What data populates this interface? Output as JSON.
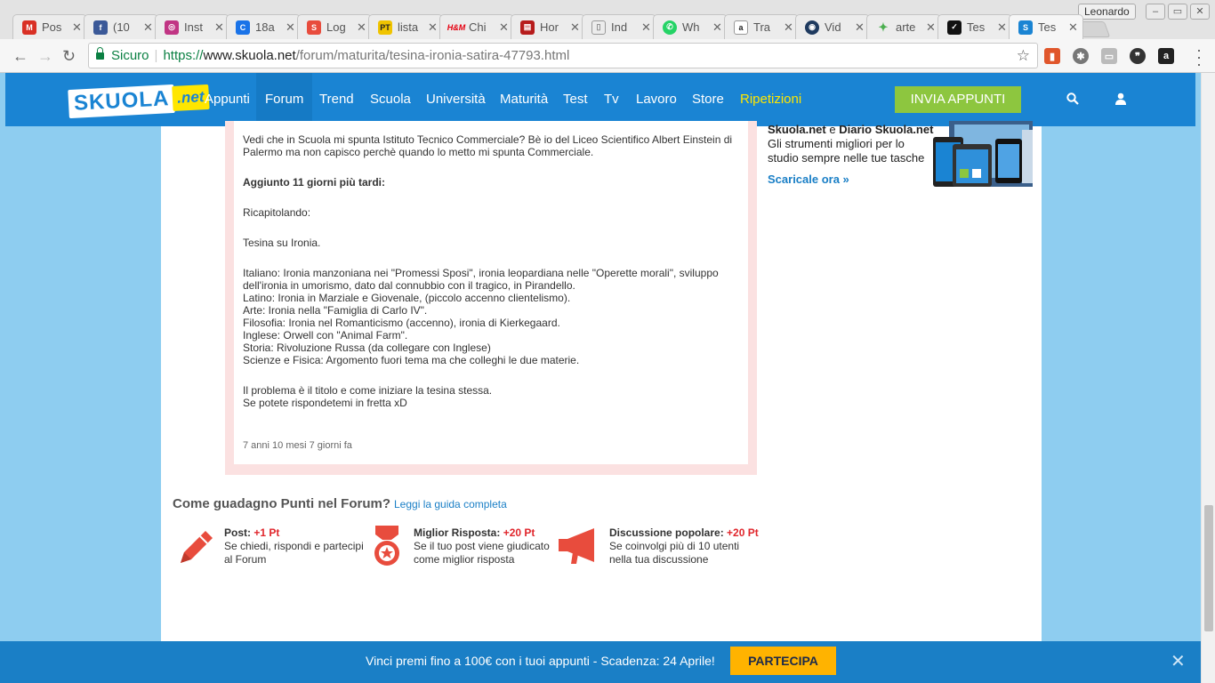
{
  "browser": {
    "tabs": [
      {
        "title": "Pos",
        "fav_label": "M",
        "fav_color": "#d93025"
      },
      {
        "title": "(10",
        "fav_label": "f",
        "fav_color": "#3b5998"
      },
      {
        "title": "Inst",
        "fav_label": "◎",
        "fav_color": "#c13584"
      },
      {
        "title": "18a",
        "fav_label": "C",
        "fav_color": "#1a73e8"
      },
      {
        "title": "Log",
        "fav_label": "S",
        "fav_color": "#e84c3d"
      },
      {
        "title": "lista",
        "fav_label": "PT",
        "fav_color": "#f0c400"
      },
      {
        "title": "Chi",
        "fav_label": "H&M",
        "fav_color": "#e50010"
      },
      {
        "title": "Hor",
        "fav_label": "▤",
        "fav_color": "#b71c1c"
      },
      {
        "title": "Ind",
        "fav_label": "▯",
        "fav_color": "#9e9e9e"
      },
      {
        "title": "Wh",
        "fav_label": "✆",
        "fav_color": "#25d366"
      },
      {
        "title": "Tra",
        "fav_label": "a",
        "fav_color": "#222222"
      },
      {
        "title": "Vid",
        "fav_label": "◉",
        "fav_color": "#1e3a5f"
      },
      {
        "title": "arte",
        "fav_label": "✦",
        "fav_color": "#4caf50"
      },
      {
        "title": "Tes",
        "fav_label": "✓",
        "fav_color": "#111111"
      },
      {
        "title": "Tes",
        "fav_label": "S",
        "fav_color": "#1a84d3"
      }
    ],
    "profile_name": "Leonardo",
    "security_label": "Sicuro",
    "url_scheme": "https://",
    "url_domain": "www.skuola.net",
    "url_path": "/forum/maturita/tesina-ironia-satira-47793.html"
  },
  "site": {
    "logo_main": "SKUOLA",
    "logo_suffix": ".net",
    "nav": [
      "Appunti",
      "Forum",
      "Trend",
      "Scuola",
      "Università",
      "Maturità",
      "Test",
      "Tv",
      "Lavoro",
      "Store",
      "Ripetizioni"
    ],
    "cta_label": "INVIA APPUNTI",
    "colors": {
      "nav_bg": "#1a84d3",
      "cta_bg": "#8dc63f",
      "highlight": "#ffe600",
      "accent_red": "#e0262c"
    }
  },
  "post": {
    "intro": "Vedi che in Scuola mi spunta Istituto Tecnico Commerciale? Bè io del Liceo Scientifico Albert Einstein di Palermo ma non capisco perchè quando lo metto mi spunta Commerciale.",
    "update_label": "Aggiunto 11 giorni più tardi:",
    "recap_label": "Ricapitolando:",
    "tesina_line": "Tesina su Ironia.",
    "subjects": [
      "Italiano: Ironia manzoniana nei \"Promessi Sposi\", ironia leopardiana nelle \"Operette morali\", sviluppo dell'ironia in umorismo, dato dal connubbio con il tragico, in Pirandello.",
      "Latino: Ironia in Marziale e Giovenale, (piccolo accenno clientelismo).",
      "Arte: Ironia nella \"Famiglia di Carlo IV\".",
      "Filosofia: Ironia nel Romanticismo (accenno), ironia di Kierkegaard.",
      "Inglese: Orwell con \"Animal Farm\".",
      "Storia: Rivoluzione Russa (da collegare con Inglese)",
      "Scienze e Fisica: Argomento fuori tema ma che colleghi le due materie."
    ],
    "closing": [
      "Il problema è il titolo e come iniziare la tesina stessa.",
      "Se potete rispondetemi in fretta xD"
    ],
    "timestamp": "7 anni 10 mesi 7 giorni fa"
  },
  "points": {
    "title": "Come guadagno Punti nel Forum?",
    "guide_link": "Leggi la guida completa",
    "items": [
      {
        "head": "Post:",
        "pts": "+1 Pt",
        "desc1": "Se chiedi, rispondi e partecipi",
        "desc2": "al Forum",
        "icon": "pencil-icon"
      },
      {
        "head": "Miglior Risposta:",
        "pts": "+20 Pt",
        "desc1": "Se il tuo post viene giudicato",
        "desc2": "come miglior risposta",
        "icon": "medal-icon"
      },
      {
        "head": "Discussione popolare:",
        "pts": "+20 Pt",
        "desc1": "Se coinvolgi più di 10 utenti",
        "desc2": "nella tua discussione",
        "icon": "megaphone-icon"
      }
    ]
  },
  "sidebar": {
    "title_a": "Skuola.net",
    "title_e": "e",
    "title_b": "Diario Skuola.net",
    "text": "Gli strumenti migliori per lo studio sempre nelle tue tasche",
    "link": "Scaricale ora »"
  },
  "banner": {
    "text": "Vinci premi fino a 100€ con i tuoi appunti - Scadenza: 24 Aprile!",
    "button": "PARTECIPA",
    "close": "✕"
  }
}
